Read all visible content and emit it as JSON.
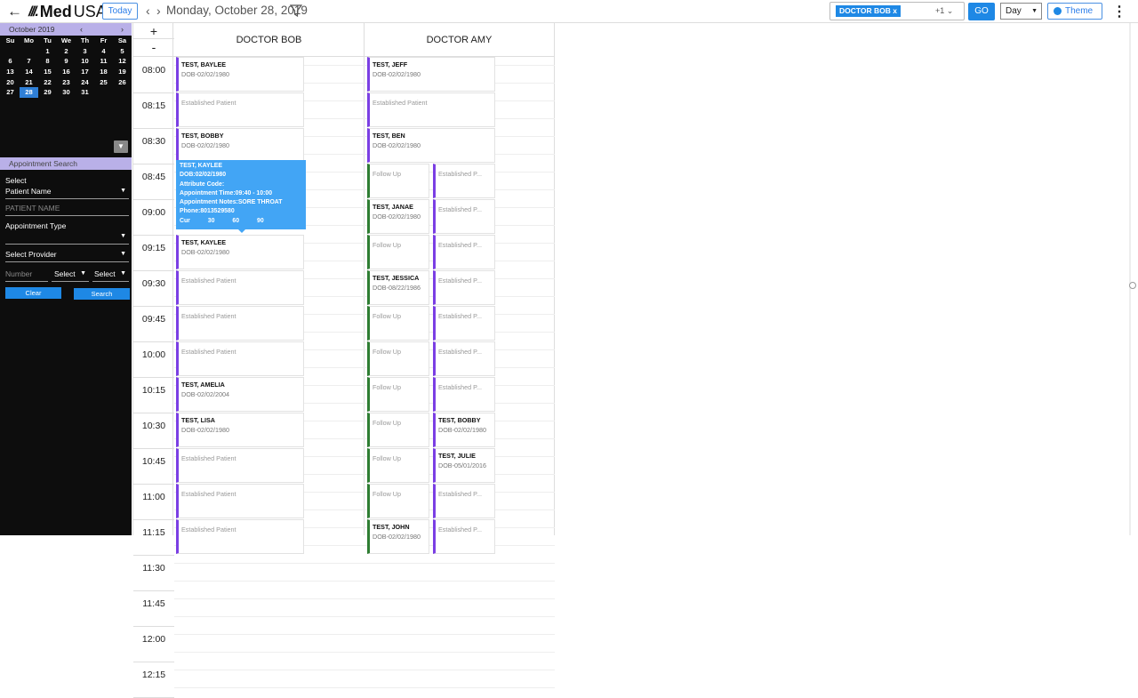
{
  "header": {
    "back_icon": "←",
    "logo_mark": "///.",
    "logo_med": "Med",
    "logo_usa": "USA",
    "today_label": "Today",
    "prev_icon": "‹",
    "next_icon": "›",
    "current_date": "Monday, October 28, 2019",
    "provider_chip": "DOCTOR BOB x",
    "provider_more": "+1 ⌄",
    "go_label": "GO",
    "view_select": "Day",
    "view_caret": "▼",
    "theme_label": "Theme",
    "menu_icon": "⋮"
  },
  "mini_calendar": {
    "month_label": "October 2019",
    "prev": "‹",
    "next": "›",
    "weekdays": [
      "Su",
      "Mo",
      "Tu",
      "We",
      "Th",
      "Fr",
      "Sa"
    ],
    "days": [
      "",
      "",
      "1",
      "2",
      "3",
      "4",
      "5",
      "6",
      "7",
      "8",
      "9",
      "10",
      "11",
      "12",
      "13",
      "14",
      "15",
      "16",
      "17",
      "18",
      "19",
      "20",
      "21",
      "22",
      "23",
      "24",
      "25",
      "26",
      "27",
      "28",
      "29",
      "30",
      "31",
      "",
      "",
      ""
    ],
    "selected_day": "28",
    "collapse_icon": "▼"
  },
  "search_panel": {
    "title": "Appointment Search",
    "select_label": "Select",
    "patient_name_select": "Patient Name",
    "patient_name_placeholder": "PATIENT NAME",
    "appointment_type_label": "Appointment Type",
    "provider_select": "Select Provider",
    "number_placeholder": "Number",
    "select_a": "Select",
    "select_b": "Select",
    "caret": "▼",
    "clear_label": "Clear",
    "search_label": "Search"
  },
  "time_column": {
    "plus": "+",
    "minus": "-",
    "times": [
      "08:00",
      "08:15",
      "08:30",
      "08:45",
      "09:00",
      "09:15",
      "09:30",
      "09:45",
      "10:00",
      "10:15",
      "10:30",
      "10:45",
      "11:00",
      "11:15",
      "11:30",
      "11:45",
      "12:00",
      "12:15"
    ]
  },
  "providers": [
    "DOCTOR BOB",
    "DOCTOR AMY"
  ],
  "appointments_bob": [
    {
      "name": "TEST, BAYLEE",
      "dob": "DOB-02/02/1980",
      "type": ""
    },
    {
      "name": "",
      "dob": "",
      "type": "Established Patient"
    },
    {
      "name": "TEST, BOBBY",
      "dob": "DOB-02/02/1980",
      "type": ""
    },
    {
      "name": "TEST, KAYLEE",
      "dob": "DOB-02/02/1980",
      "type": ""
    },
    {
      "name": "",
      "dob": "",
      "type": "Established Patient"
    },
    {
      "name": "",
      "dob": "",
      "type": "Established Patient"
    },
    {
      "name": "",
      "dob": "",
      "type": "Established Patient"
    },
    {
      "name": "TEST, AMELIA",
      "dob": "DOB-02/02/2004",
      "type": ""
    },
    {
      "name": "TEST, LISA",
      "dob": "DOB-02/02/1980",
      "type": ""
    },
    {
      "name": "",
      "dob": "",
      "type": "Established Patient"
    },
    {
      "name": "",
      "dob": "",
      "type": "Established Patient"
    },
    {
      "name": "",
      "dob": "",
      "type": "Established Patient"
    }
  ],
  "appointments_amy_left": [
    {
      "name": "TEST, JEFF",
      "dob": "DOB-02/02/1980",
      "type": ""
    },
    {
      "name": "",
      "dob": "",
      "type": "Established Patient"
    },
    {
      "name": "TEST, BEN",
      "dob": "DOB-02/02/1980",
      "type": ""
    },
    {
      "name": "",
      "dob": "",
      "type": "Follow Up"
    },
    {
      "name": "TEST, JANAE",
      "dob": "DOB-02/02/1980",
      "type": ""
    },
    {
      "name": "",
      "dob": "",
      "type": "Follow Up"
    },
    {
      "name": "TEST, JESSICA",
      "dob": "DOB-08/22/1986",
      "type": ""
    },
    {
      "name": "",
      "dob": "",
      "type": "Follow Up"
    },
    {
      "name": "",
      "dob": "",
      "type": "Follow Up"
    },
    {
      "name": "",
      "dob": "",
      "type": "Follow Up"
    },
    {
      "name": "",
      "dob": "",
      "type": "Follow Up"
    },
    {
      "name": "",
      "dob": "",
      "type": "Follow Up"
    },
    {
      "name": "",
      "dob": "",
      "type": "Follow Up"
    },
    {
      "name": "TEST, JOHN",
      "dob": "DOB-02/02/1980",
      "type": ""
    }
  ],
  "appointments_amy_right": [
    {
      "name": "",
      "dob": "",
      "type": "Established P..."
    },
    {
      "name": "",
      "dob": "",
      "type": "Established P..."
    },
    {
      "name": "",
      "dob": "",
      "type": "Established P..."
    },
    {
      "name": "",
      "dob": "",
      "type": "Established P..."
    },
    {
      "name": "",
      "dob": "",
      "type": "Established P..."
    },
    {
      "name": "",
      "dob": "",
      "type": "Established P..."
    },
    {
      "name": "",
      "dob": "",
      "type": "Established P..."
    },
    {
      "name": "TEST, BOBBY",
      "dob": "DOB-02/02/1980",
      "type": ""
    },
    {
      "name": "TEST, JULIE",
      "dob": "DOB-05/01/2016",
      "type": ""
    },
    {
      "name": "",
      "dob": "",
      "type": "Established P..."
    },
    {
      "name": "",
      "dob": "",
      "type": "Established P..."
    }
  ],
  "tooltip": {
    "name": "TEST, KAYLEE",
    "dob": "DOB:02/02/1980",
    "attribute": "Attribute Code:",
    "time": "Appointment Time:09:40 - 10:00",
    "notes": "Appointment Notes:SORE THROAT",
    "phone": "Phone:8013529580",
    "cur": "Cur",
    "c30": "30",
    "c60": "60",
    "c90": "90"
  }
}
